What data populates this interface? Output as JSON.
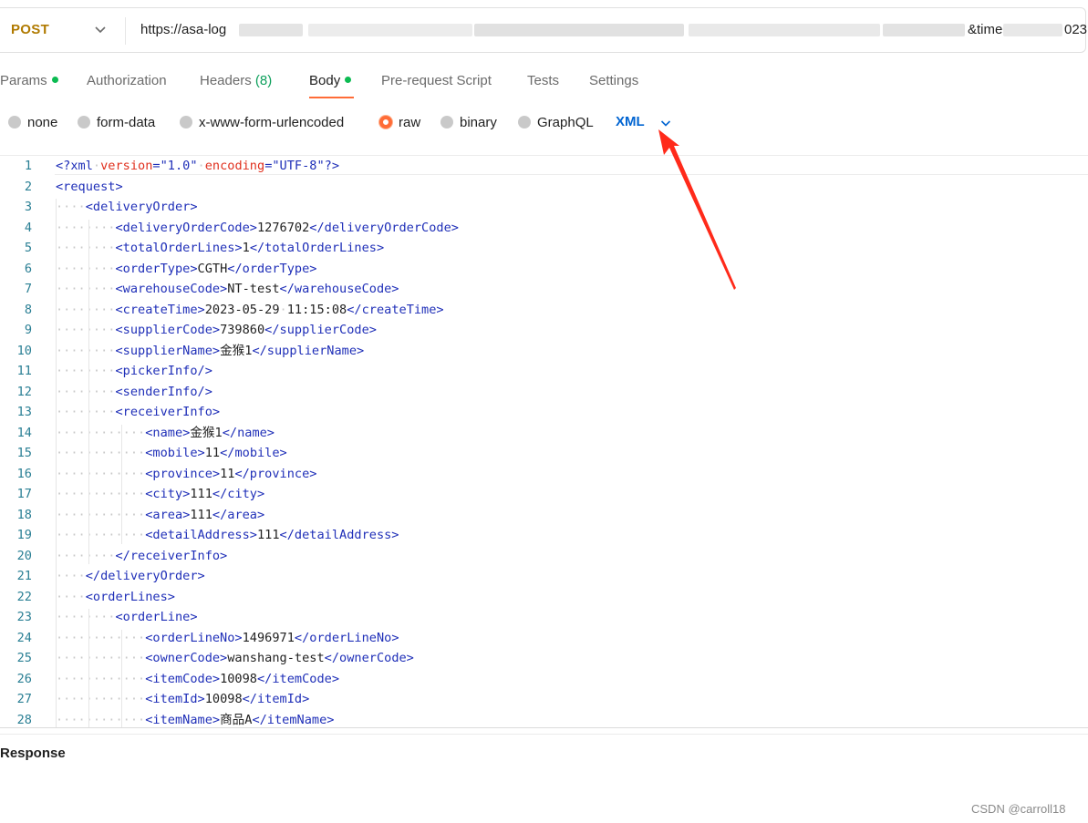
{
  "request": {
    "method": "POST",
    "url_start": "https://asa-log",
    "url_mid": "&time",
    "url_end": "023"
  },
  "tabs": [
    {
      "label": "Params",
      "has_dot": true
    },
    {
      "label": "Authorization"
    },
    {
      "label": "Headers",
      "count": "(8)"
    },
    {
      "label": "Body",
      "has_dot": true,
      "active": true
    },
    {
      "label": "Pre-request Script"
    },
    {
      "label": "Tests"
    },
    {
      "label": "Settings"
    }
  ],
  "body_types": [
    "none",
    "form-data",
    "x-www-form-urlencoded",
    "raw",
    "binary",
    "GraphQL"
  ],
  "body_type_selected": "raw",
  "language": "XML",
  "code_lines": [
    {
      "n": "1",
      "indent": 0,
      "kind": "decl"
    },
    {
      "n": "2",
      "indent": 0,
      "open": "request"
    },
    {
      "n": "3",
      "indent": 1,
      "open": "deliveryOrder"
    },
    {
      "n": "4",
      "indent": 2,
      "elem": "deliveryOrderCode",
      "text": "1276702"
    },
    {
      "n": "5",
      "indent": 2,
      "elem": "totalOrderLines",
      "text": "1"
    },
    {
      "n": "6",
      "indent": 2,
      "elem": "orderType",
      "text": "CGTH"
    },
    {
      "n": "7",
      "indent": 2,
      "elem": "warehouseCode",
      "text": "NT-test"
    },
    {
      "n": "8",
      "indent": 2,
      "elem": "createTime",
      "text": "2023-05-29·11:15:08"
    },
    {
      "n": "9",
      "indent": 2,
      "elem": "supplierCode",
      "text": "739860"
    },
    {
      "n": "10",
      "indent": 2,
      "elem": "supplierName",
      "text": "金猴1"
    },
    {
      "n": "11",
      "indent": 2,
      "empty": "pickerInfo"
    },
    {
      "n": "12",
      "indent": 2,
      "empty": "senderInfo"
    },
    {
      "n": "13",
      "indent": 2,
      "open": "receiverInfo"
    },
    {
      "n": "14",
      "indent": 3,
      "elem": "name",
      "text": "金猴1"
    },
    {
      "n": "15",
      "indent": 3,
      "elem": "mobile",
      "text": "11"
    },
    {
      "n": "16",
      "indent": 3,
      "elem": "province",
      "text": "11"
    },
    {
      "n": "17",
      "indent": 3,
      "elem": "city",
      "text": "111"
    },
    {
      "n": "18",
      "indent": 3,
      "elem": "area",
      "text": "111"
    },
    {
      "n": "19",
      "indent": 3,
      "elem": "detailAddress",
      "text": "111"
    },
    {
      "n": "20",
      "indent": 2,
      "close": "receiverInfo"
    },
    {
      "n": "21",
      "indent": 1,
      "close": "deliveryOrder"
    },
    {
      "n": "22",
      "indent": 1,
      "open": "orderLines"
    },
    {
      "n": "23",
      "indent": 2,
      "open": "orderLine"
    },
    {
      "n": "24",
      "indent": 3,
      "elem": "orderLineNo",
      "text": "1496971"
    },
    {
      "n": "25",
      "indent": 3,
      "elem": "ownerCode",
      "text": "wanshang-test"
    },
    {
      "n": "26",
      "indent": 3,
      "elem": "itemCode",
      "text": "10098"
    },
    {
      "n": "27",
      "indent": 3,
      "elem": "itemId",
      "text": "10098"
    },
    {
      "n": "28",
      "indent": 3,
      "elem": "itemName",
      "text": "商品A"
    }
  ],
  "xml_decl": {
    "version": "1.0",
    "encoding": "UTF-8"
  },
  "response_label": "Response",
  "watermark": "CSDN @carroll18",
  "colors": {
    "accent": "#ff6c37",
    "arrow": "#ff2a1a",
    "tag": "#1f2fb8",
    "attr": "#e0301e",
    "method": "#b07a00"
  }
}
